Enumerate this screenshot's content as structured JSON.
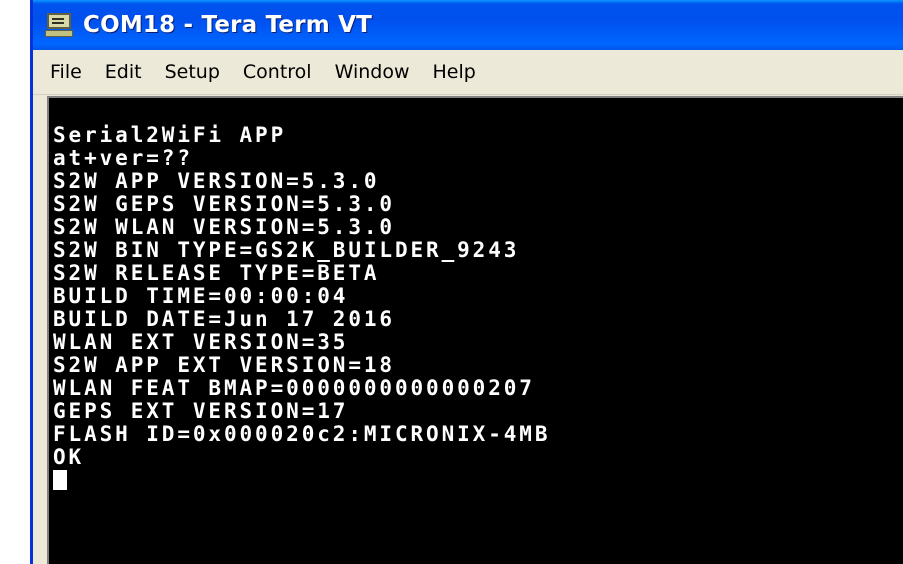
{
  "window": {
    "title": "COM18 - Tera Term VT",
    "icon": "teraterm-icon"
  },
  "menu": {
    "items": [
      "File",
      "Edit",
      "Setup",
      "Control",
      "Window",
      "Help"
    ]
  },
  "terminal": {
    "lines": [
      "Serial2WiFi APP",
      "at+ver=??",
      "S2W APP VERSION=5.3.0",
      "S2W GEPS VERSION=5.3.0",
      "S2W WLAN VERSION=5.3.0",
      "S2W BIN TYPE=GS2K_BUILDER_9243",
      "S2W RELEASE TYPE=BETA",
      "BUILD TIME=00:00:04",
      "BUILD DATE=Jun 17 2016",
      "WLAN EXT VERSION=35",
      "S2W APP EXT VERSION=18",
      "WLAN FEAT BMAP=0000000000000207",
      "GEPS EXT VERSION=17",
      "FLASH ID=0x000020c2:MICRONIX-4MB",
      "OK"
    ],
    "background": "#000000",
    "foreground": "#ffffff"
  }
}
